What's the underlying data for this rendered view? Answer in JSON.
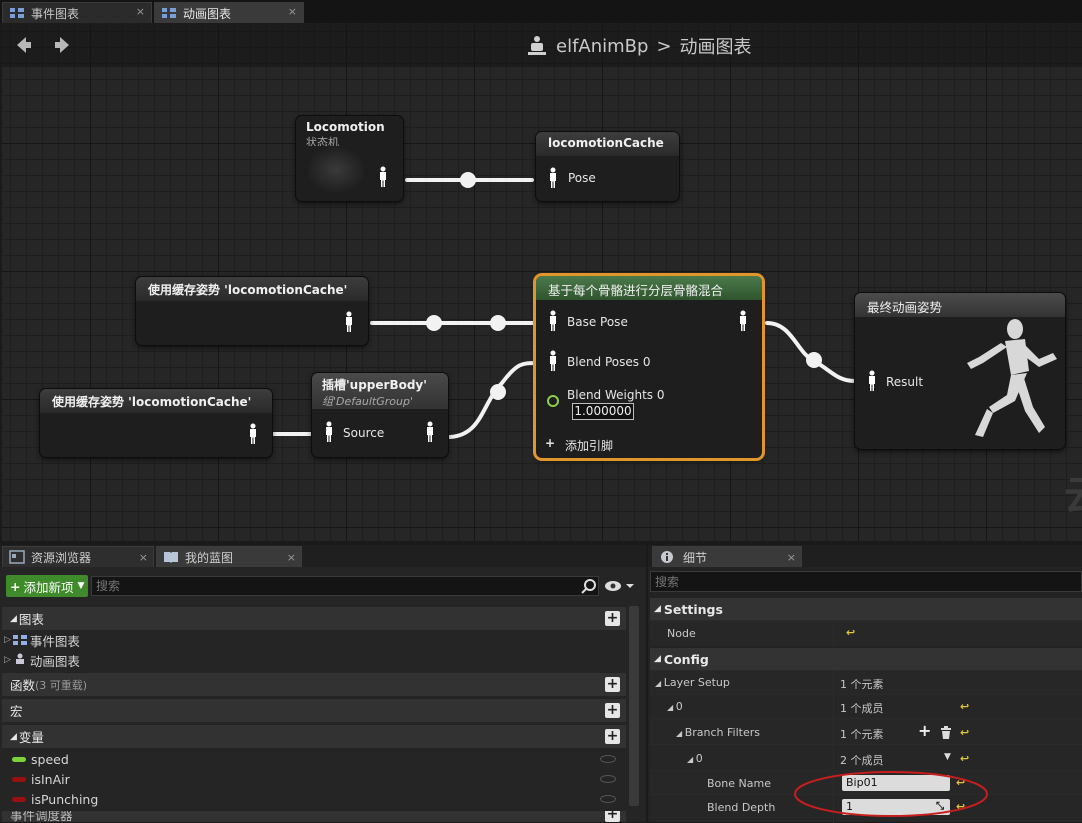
{
  "tabs": [
    {
      "label": "事件图表",
      "close": "×"
    },
    {
      "label": "动画图表",
      "close": "×"
    }
  ],
  "header": {
    "blueprint": "elfAnimBp",
    "separator": ">",
    "graph": "动画图表"
  },
  "nodes": {
    "locomotion": {
      "title": "Locomotion",
      "subtitle": "状态机"
    },
    "cache": {
      "title": "locomotionCache",
      "pin": "Pose"
    },
    "use_cache_1": {
      "title": "使用缓存姿势  'locomotionCache'"
    },
    "use_cache_2": {
      "title": "使用缓存姿势  'locomotionCache'"
    },
    "slot": {
      "title": "插槽'upperBody'",
      "subtitle": "组'DefaultGroup'",
      "pin": "Source"
    },
    "blend": {
      "title": "基于每个骨骼进行分层骨骼混合",
      "pins": [
        "Base Pose",
        "Blend Poses 0",
        "Blend Weights 0"
      ],
      "weight_value": "1.000000",
      "add_pin": "添加引脚"
    },
    "final": {
      "title": "最终动画姿势",
      "pin": "Result"
    }
  },
  "left_panel": {
    "tabs": [
      {
        "label": "资源浏览器",
        "close": "×"
      },
      {
        "label": "我的蓝图",
        "close": "×"
      }
    ],
    "add_button": "添加新项",
    "search_placeholder": "搜索",
    "sections": {
      "graphs": "图表",
      "graph_items": [
        "事件图表",
        "动画图表"
      ],
      "functions": "函数",
      "functions_note": "(3 可重载)",
      "macros": "宏",
      "variables": "变量",
      "var_items": [
        {
          "name": "speed",
          "color": "#7cd23a"
        },
        {
          "name": "isInAir",
          "color": "#9a1010"
        },
        {
          "name": "isPunching",
          "color": "#9a1010"
        }
      ],
      "cut_off": "事件调度器"
    }
  },
  "details": {
    "tab": "细节",
    "tab_close": "×",
    "search_placeholder": "搜索",
    "settings": "Settings",
    "node_label": "Node",
    "config": "Config",
    "rows": [
      {
        "label": "Layer Setup",
        "value": "1 个元素"
      },
      {
        "label": "0",
        "value": "1 个成员"
      },
      {
        "label": "Branch Filters",
        "value": "1 个元素"
      },
      {
        "label": "0",
        "value": "2 个成员"
      },
      {
        "label": "Bone Name",
        "value": "Bip01"
      },
      {
        "label": "Blend Depth",
        "value": "1"
      }
    ],
    "highlight_color": "#c81e1e"
  }
}
